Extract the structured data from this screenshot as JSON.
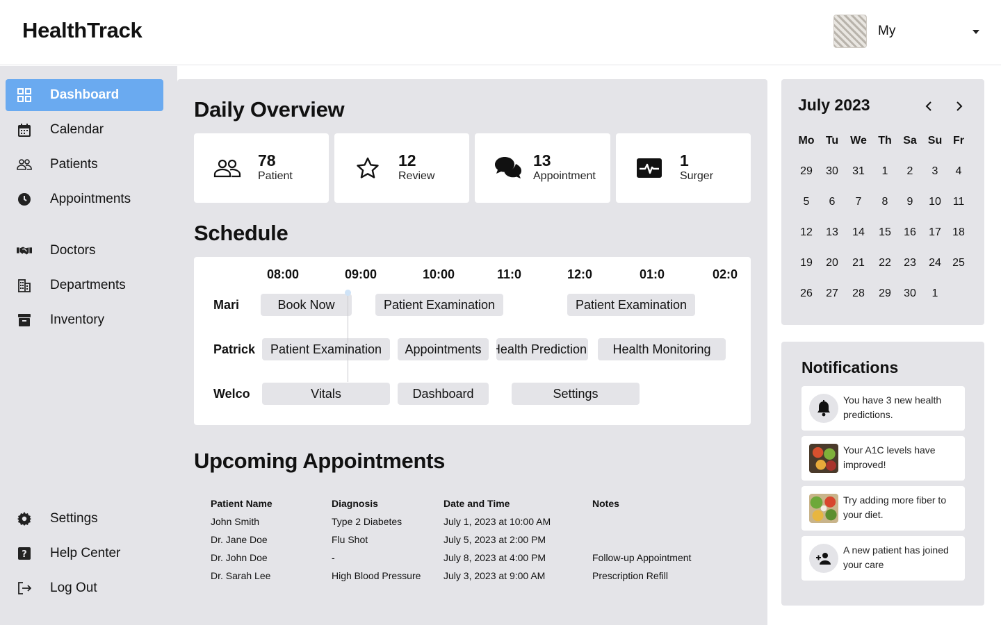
{
  "header": {
    "brand": "HealthTrack",
    "user_name": "My"
  },
  "sidebar": {
    "items": [
      {
        "label": "Dashboard",
        "icon": "grid-icon",
        "active": true
      },
      {
        "label": "Calendar",
        "icon": "calendar-icon"
      },
      {
        "label": "Patients",
        "icon": "people-icon"
      },
      {
        "label": "Appointments",
        "icon": "clock-icon"
      },
      {
        "label": "Doctors",
        "icon": "handshake-icon"
      },
      {
        "label": "Departments",
        "icon": "building-icon"
      },
      {
        "label": "Inventory",
        "icon": "archive-icon"
      }
    ],
    "bottom": [
      {
        "label": "Settings",
        "icon": "gear-icon"
      },
      {
        "label": "Help Center",
        "icon": "help-icon"
      },
      {
        "label": "Log Out",
        "icon": "logout-icon"
      }
    ]
  },
  "overview": {
    "title": "Daily Overview",
    "stats": [
      {
        "value": "78",
        "label": "Patient",
        "icon": "people-icon"
      },
      {
        "value": "12",
        "label": "Review",
        "icon": "star-icon"
      },
      {
        "value": "13",
        "label": "Appointment",
        "icon": "chat-bubbles-icon"
      },
      {
        "value": "1",
        "label": "Surger",
        "icon": "heartbeat-icon"
      }
    ]
  },
  "schedule": {
    "title": "Schedule",
    "times": [
      "08:00",
      "09:00",
      "10:00",
      "11:0",
      "12:0",
      "01:0",
      "02:0"
    ],
    "rows": [
      {
        "name": "Mari",
        "events": [
          "Book Now",
          "Patient Examination",
          "Patient Examination"
        ]
      },
      {
        "name": "Patrick",
        "events": [
          "Patient Examination",
          "Appointments",
          "Health Prediction",
          "Health Monitoring"
        ]
      },
      {
        "name": "Welco",
        "events": [
          "Vitals",
          "Dashboard",
          "Settings"
        ]
      }
    ]
  },
  "appointments": {
    "title": "Upcoming Appointments",
    "columns": [
      "Patient Name",
      "Diagnosis",
      "Date and Time",
      "Notes"
    ],
    "rows": [
      [
        "John Smith",
        "Type 2 Diabetes",
        "July 1, 2023 at 10:00 AM",
        ""
      ],
      [
        "Dr. Jane Doe",
        "Flu Shot",
        "July 5, 2023 at 2:00 PM",
        ""
      ],
      [
        "Dr. John Doe",
        "-",
        "July 8, 2023 at 4:00 PM",
        "Follow-up Appointment"
      ],
      [
        "Dr. Sarah Lee",
        "High Blood Pressure",
        "July 3, 2023 at 9:00 AM",
        "Prescription Refill"
      ]
    ]
  },
  "calendar": {
    "title": "July 2023",
    "weekdays": [
      "Mo",
      "Tu",
      "We",
      "Th",
      "Sa",
      "Su",
      "Fr"
    ],
    "weeks": [
      [
        "29",
        "30",
        "31",
        "1",
        "2",
        "3",
        "4"
      ],
      [
        "5",
        "6",
        "7",
        "8",
        "9",
        "10",
        "11"
      ],
      [
        "12",
        "13",
        "14",
        "15",
        "16",
        "17",
        "18"
      ],
      [
        "19",
        "20",
        "21",
        "22",
        "23",
        "24",
        "25"
      ],
      [
        "26",
        "27",
        "28",
        "29",
        "30",
        "1",
        ""
      ]
    ]
  },
  "notifications": {
    "title": "Notifications",
    "items": [
      {
        "text": "You have 3 new health predictions.",
        "icon": "bell-icon"
      },
      {
        "text": "Your A1C levels have improved!",
        "icon": "food-photo-icon"
      },
      {
        "text": "Try adding more fiber to your diet.",
        "icon": "salad-photo-icon"
      },
      {
        "text": "A new patient has joined your care",
        "icon": "person-add-icon"
      }
    ]
  }
}
